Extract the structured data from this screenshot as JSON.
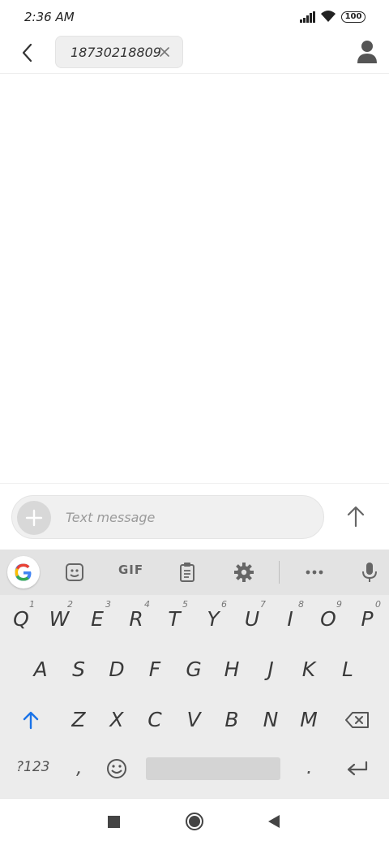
{
  "status_bar": {
    "time": "2:36 AM",
    "battery": "100"
  },
  "header": {
    "recipient": "18730218809"
  },
  "compose": {
    "placeholder": "Text message"
  },
  "keyboard": {
    "toolbar": {
      "gif_label": "GIF"
    },
    "row1": [
      {
        "label": "Q",
        "hint": "1"
      },
      {
        "label": "W",
        "hint": "2"
      },
      {
        "label": "E",
        "hint": "3"
      },
      {
        "label": "R",
        "hint": "4"
      },
      {
        "label": "T",
        "hint": "5"
      },
      {
        "label": "Y",
        "hint": "6"
      },
      {
        "label": "U",
        "hint": "7"
      },
      {
        "label": "I",
        "hint": "8"
      },
      {
        "label": "O",
        "hint": "9"
      },
      {
        "label": "P",
        "hint": "0"
      }
    ],
    "row2": [
      "A",
      "S",
      "D",
      "F",
      "G",
      "H",
      "J",
      "K",
      "L"
    ],
    "row3": [
      "Z",
      "X",
      "C",
      "V",
      "B",
      "N",
      "M"
    ],
    "row4": {
      "symbols": "?123",
      "comma": ",",
      "period": "."
    }
  },
  "icons": {
    "back": "back-arrow-icon",
    "clear": "close-icon",
    "contact": "person-icon",
    "attach": "plus-icon",
    "send": "send-arrow-icon",
    "google": "google-g-icon",
    "sticker": "sticker-icon",
    "clipboard": "clipboard-icon",
    "settings": "gear-icon",
    "more": "more-dots-icon",
    "mic": "mic-icon",
    "shift": "shift-arrow-icon",
    "backspace": "backspace-icon",
    "emoji": "emoji-icon",
    "enter": "enter-icon"
  },
  "colors": {
    "accent": "#1a73e8",
    "keyboard_bg": "#ececec",
    "toolbar_bg": "#e3e3e3"
  }
}
